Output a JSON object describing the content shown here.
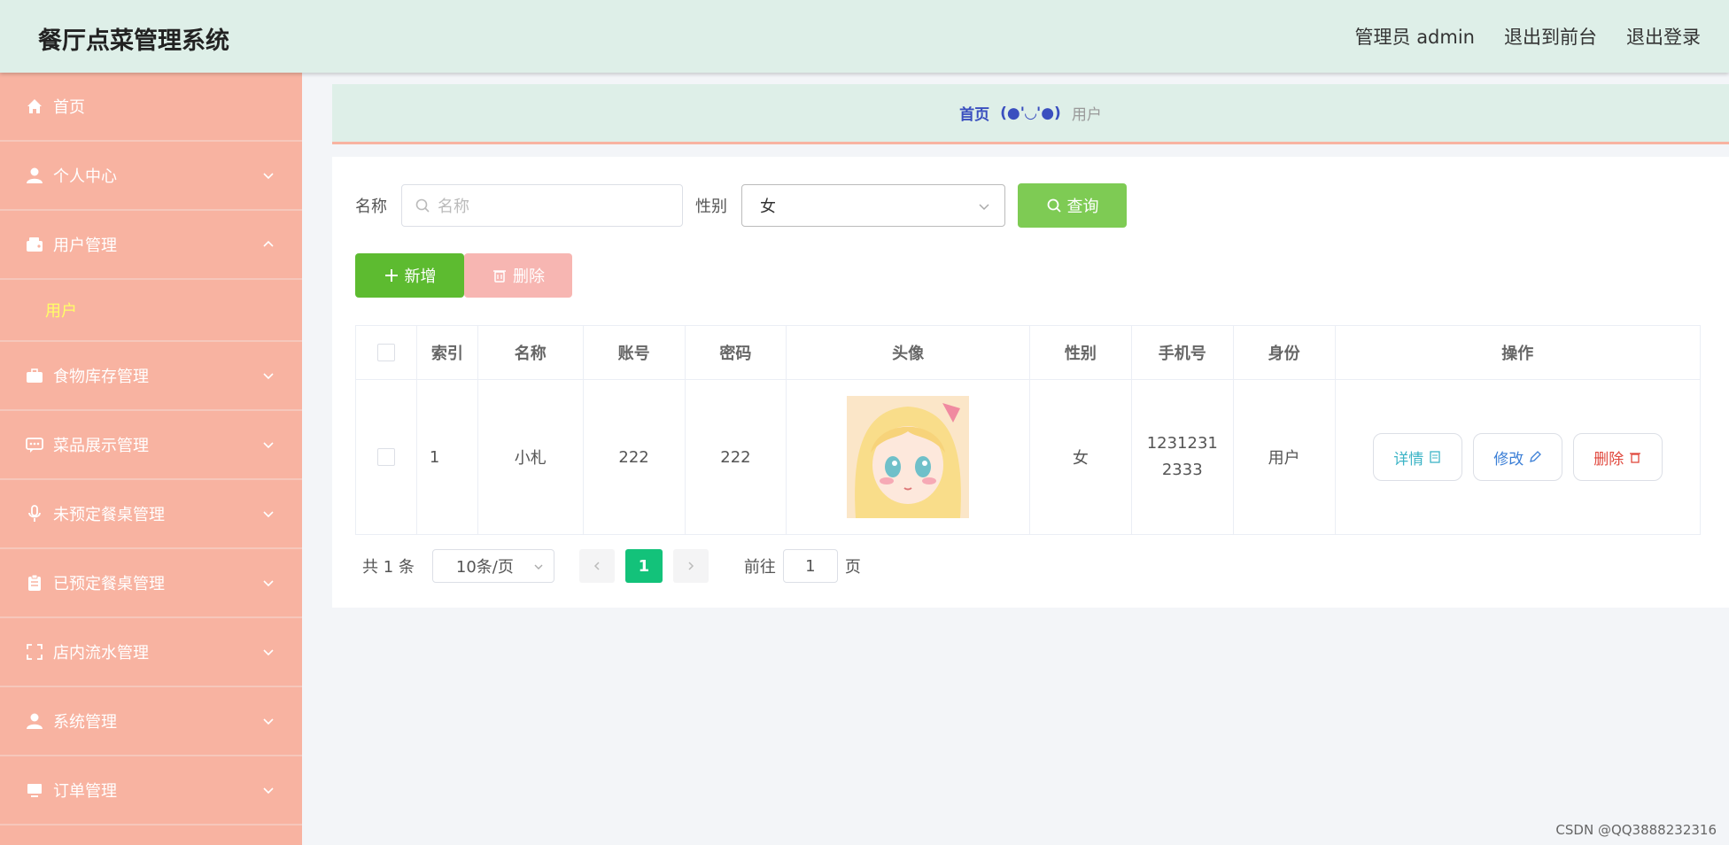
{
  "header": {
    "title": "餐厅点菜管理系统",
    "admin": "管理员 admin",
    "to_front": "退出到前台",
    "logout": "退出登录"
  },
  "sidebar": {
    "items": [
      {
        "label": "首页",
        "icon": "home-icon"
      },
      {
        "label": "个人中心",
        "icon": "person-icon"
      },
      {
        "label": "用户管理",
        "icon": "wallet-icon"
      },
      {
        "label": "食物库存管理",
        "icon": "briefcase-icon"
      },
      {
        "label": "菜品展示管理",
        "icon": "chat-icon"
      },
      {
        "label": "未预定餐桌管理",
        "icon": "mic-icon"
      },
      {
        "label": "已预定餐桌管理",
        "icon": "clipboard-icon"
      },
      {
        "label": "店内流水管理",
        "icon": "fullscreen-icon"
      },
      {
        "label": "系统管理",
        "icon": "person-icon"
      },
      {
        "label": "订单管理",
        "icon": "monitor-icon"
      }
    ],
    "sub_active": "用户"
  },
  "breadcrumb": {
    "home": "首页",
    "separator": "(●'◡'●)",
    "current": "用户"
  },
  "filters": {
    "name_label": "名称",
    "name_placeholder": "名称",
    "gender_label": "性别",
    "gender_value": "女",
    "query_label": "查询"
  },
  "actions": {
    "add_label": "新增",
    "delete_label": "删除"
  },
  "table": {
    "headers": [
      "索引",
      "名称",
      "账号",
      "密码",
      "头像",
      "性别",
      "手机号",
      "身份",
      "操作"
    ],
    "rows": [
      {
        "index": "1",
        "name": "小札",
        "account": "222",
        "password": "222",
        "gender": "女",
        "phone": "1231231 2333",
        "role": "用户"
      }
    ],
    "op_detail": "详情",
    "op_edit": "修改",
    "op_delete": "删除"
  },
  "pagination": {
    "total": "共 1 条",
    "page_size": "10条/页",
    "current_page": "1",
    "goto_label": "前往",
    "goto_value": "1",
    "page_unit": "页"
  },
  "watermark": "CSDN @QQ3888232316",
  "colors": {
    "sidebar": "#f8b3a1",
    "header": "#deefe8",
    "primary_green": "#5dbb30",
    "page_active": "#13c27a"
  }
}
